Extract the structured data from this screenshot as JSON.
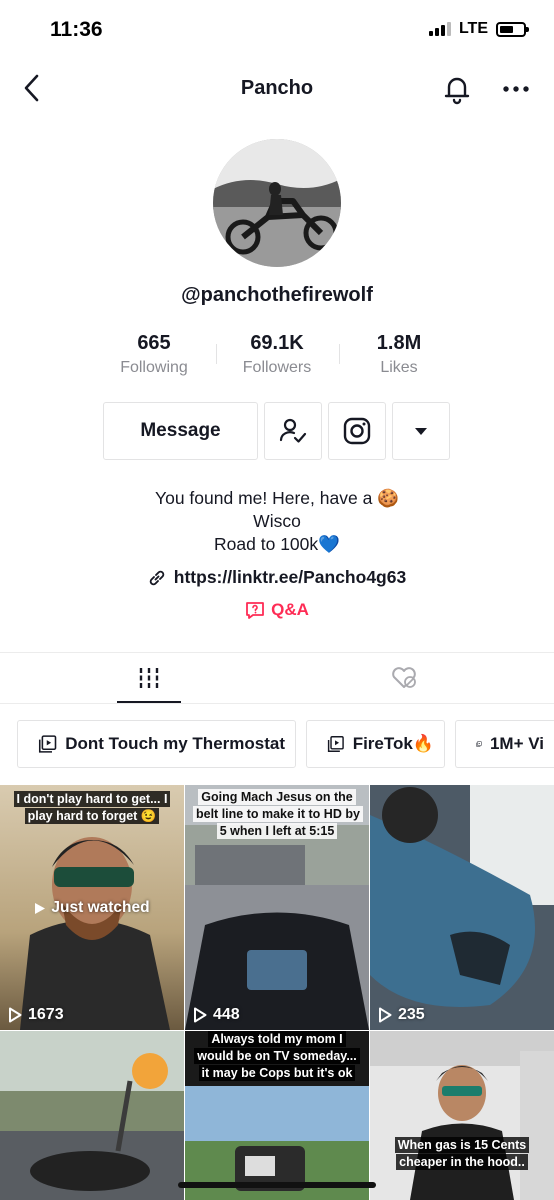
{
  "status_bar": {
    "time": "11:36",
    "network": "LTE",
    "battery_fraction": 0.6
  },
  "nav": {
    "title": "Pancho"
  },
  "profile": {
    "handle": "@panchothefirewolf"
  },
  "stats": [
    {
      "number": "665",
      "label": "Following"
    },
    {
      "number": "69.1K",
      "label": "Followers"
    },
    {
      "number": "1.8M",
      "label": "Likes"
    }
  ],
  "actions": {
    "message_label": "Message"
  },
  "bio": {
    "lines": [
      "You found me! Here, have a 🍪",
      "Wisco",
      "Road to 100k💙"
    ],
    "link": "https://linktr.ee/Pancho4g63",
    "qa_label": "Q&A"
  },
  "colors": {
    "accent": "#fe2c55",
    "text": "#161823",
    "muted": "#8a8b91",
    "border": "#e3e3e4"
  },
  "playlists": [
    {
      "label": "Dont Touch my Thermostat"
    },
    {
      "label": "FireTok🔥"
    },
    {
      "label": "1M+ Vi"
    }
  ],
  "videos": [
    {
      "caption": "I don't play hard to get... I play hard to forget 😉",
      "overlay": "Just watched",
      "views": "1673"
    },
    {
      "caption": "Going Mach Jesus on the belt line to make it to HD by 5 when I left at 5:15",
      "views": "448"
    },
    {
      "caption": "",
      "views": "235"
    },
    {
      "caption": ""
    },
    {
      "caption": "Always told my mom I would be on TV someday... it may be Cops but it's ok"
    },
    {
      "caption": "When gas is 15 Cents cheaper in the hood.."
    }
  ]
}
